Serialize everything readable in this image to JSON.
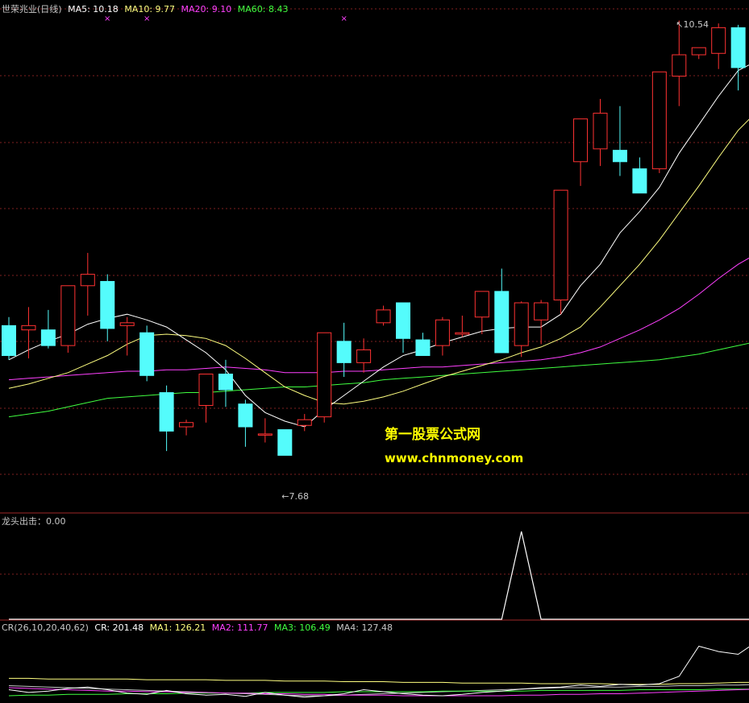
{
  "main_panel": {
    "title": "世荣兆业(日线)",
    "legend": [
      {
        "label": "MA5: 10.18",
        "color": "#ffffff"
      },
      {
        "label": "MA10: 9.77",
        "color": "#ffff80"
      },
      {
        "label": "MA20: 9.10",
        "color": "#ff40ff"
      },
      {
        "label": "MA60: 8.43",
        "color": "#40ff40"
      }
    ],
    "high_label": "10.54",
    "low_label": "7.68"
  },
  "indicator_panel": {
    "label": "龙头出击：0.00"
  },
  "cr_panel": {
    "legend": [
      {
        "label": "CR(26,10,20,40,62)",
        "color": "#c8c8c8"
      },
      {
        "label": "CR: 201.48",
        "color": "#ffffff"
      },
      {
        "label": "MA1: 126.21",
        "color": "#ffff80"
      },
      {
        "label": "MA2: 111.77",
        "color": "#ff40ff"
      },
      {
        "label": "MA3: 106.49",
        "color": "#40ff40"
      },
      {
        "label": "MA4: 127.48",
        "color": "#c8c8c8"
      }
    ]
  },
  "watermark": {
    "line1": "第一股票公式网",
    "line2": "www.chnmoney.com"
  },
  "colors": {
    "up": "#ff3232",
    "down": "#54fcfc",
    "grid": "#802020",
    "ma5": "#ffffff",
    "ma10": "#ffff80",
    "ma20": "#ff40ff",
    "ma60": "#40ff40",
    "marker": "#ff40ff"
  },
  "chart_data": {
    "type": "candlestick",
    "ylim": [
      7.4,
      10.75
    ],
    "candles": [
      {
        "o": 8.59,
        "h": 8.65,
        "l": 8.35,
        "c": 8.38
      },
      {
        "o": 8.56,
        "h": 8.72,
        "l": 8.36,
        "c": 8.59
      },
      {
        "o": 8.56,
        "h": 8.7,
        "l": 8.43,
        "c": 8.45
      },
      {
        "o": 8.45,
        "h": 8.87,
        "l": 8.4,
        "c": 8.87
      },
      {
        "o": 8.87,
        "h": 9.1,
        "l": 8.66,
        "c": 8.95
      },
      {
        "o": 8.9,
        "h": 8.95,
        "l": 8.48,
        "c": 8.57
      },
      {
        "o": 8.59,
        "h": 8.65,
        "l": 8.38,
        "c": 8.61
      },
      {
        "o": 8.54,
        "h": 8.59,
        "l": 8.2,
        "c": 8.24
      },
      {
        "o": 8.12,
        "h": 8.17,
        "l": 7.71,
        "c": 7.85
      },
      {
        "o": 7.88,
        "h": 7.93,
        "l": 7.82,
        "c": 7.91
      },
      {
        "o": 8.03,
        "h": 8.25,
        "l": 7.91,
        "c": 8.25
      },
      {
        "o": 8.25,
        "h": 8.35,
        "l": 8.02,
        "c": 8.14
      },
      {
        "o": 8.04,
        "h": 8.07,
        "l": 7.74,
        "c": 7.88
      },
      {
        "o": 7.83,
        "h": 7.94,
        "l": 7.77,
        "c": 7.83
      },
      {
        "o": 7.86,
        "h": 7.86,
        "l": 7.69,
        "c": 7.68
      },
      {
        "o": 7.89,
        "h": 7.97,
        "l": 7.85,
        "c": 7.93
      },
      {
        "o": 7.95,
        "h": 8.54,
        "l": 7.91,
        "c": 8.54
      },
      {
        "o": 8.48,
        "h": 8.61,
        "l": 8.23,
        "c": 8.33
      },
      {
        "o": 8.33,
        "h": 8.5,
        "l": 8.26,
        "c": 8.42
      },
      {
        "o": 8.61,
        "h": 8.73,
        "l": 8.59,
        "c": 8.7
      },
      {
        "o": 8.75,
        "h": 8.75,
        "l": 8.4,
        "c": 8.5
      },
      {
        "o": 8.49,
        "h": 8.54,
        "l": 8.38,
        "c": 8.38
      },
      {
        "o": 8.45,
        "h": 8.65,
        "l": 8.38,
        "c": 8.63
      },
      {
        "o": 8.53,
        "h": 8.66,
        "l": 8.51,
        "c": 8.54
      },
      {
        "o": 8.65,
        "h": 8.83,
        "l": 8.53,
        "c": 8.83
      },
      {
        "o": 8.83,
        "h": 8.99,
        "l": 8.4,
        "c": 8.4
      },
      {
        "o": 8.45,
        "h": 8.76,
        "l": 8.37,
        "c": 8.75
      },
      {
        "o": 8.63,
        "h": 8.77,
        "l": 8.46,
        "c": 8.75
      },
      {
        "o": 8.77,
        "h": 9.53,
        "l": 8.67,
        "c": 9.54
      },
      {
        "o": 9.74,
        "h": 9.96,
        "l": 9.57,
        "c": 10.04
      },
      {
        "o": 9.83,
        "h": 10.18,
        "l": 9.71,
        "c": 10.08
      },
      {
        "o": 9.82,
        "h": 10.13,
        "l": 9.64,
        "c": 9.74
      },
      {
        "o": 9.69,
        "h": 9.77,
        "l": 9.52,
        "c": 9.52
      },
      {
        "o": 9.69,
        "h": 10.35,
        "l": 9.66,
        "c": 10.37
      },
      {
        "o": 10.34,
        "h": 10.73,
        "l": 10.13,
        "c": 10.49
      },
      {
        "o": 10.49,
        "h": 10.54,
        "l": 10.46,
        "c": 10.54
      },
      {
        "o": 10.5,
        "h": 10.71,
        "l": 10.39,
        "c": 10.68
      },
      {
        "o": 10.68,
        "h": 10.7,
        "l": 10.24,
        "c": 10.4
      },
      {
        "o": 10.36,
        "h": 10.7,
        "l": 10.29,
        "c": 10.6
      }
    ],
    "ma5": [
      8.35,
      8.42,
      8.48,
      8.53,
      8.6,
      8.64,
      8.67,
      8.63,
      8.58,
      8.49,
      8.4,
      8.28,
      8.1,
      7.98,
      7.92,
      7.88,
      8.0,
      8.1,
      8.2,
      8.3,
      8.38,
      8.42,
      8.47,
      8.51,
      8.55,
      8.57,
      8.58,
      8.58,
      8.67,
      8.87,
      9.02,
      9.24,
      9.39,
      9.56,
      9.8,
      10.0,
      10.2,
      10.38,
      10.45
    ],
    "ma10": [
      8.15,
      8.18,
      8.22,
      8.26,
      8.32,
      8.38,
      8.46,
      8.52,
      8.53,
      8.52,
      8.5,
      8.45,
      8.36,
      8.26,
      8.16,
      8.1,
      8.05,
      8.04,
      8.06,
      8.09,
      8.13,
      8.18,
      8.23,
      8.27,
      8.31,
      8.35,
      8.4,
      8.44,
      8.5,
      8.58,
      8.72,
      8.87,
      9.02,
      9.19,
      9.38,
      9.57,
      9.77,
      9.96,
      10.1
    ],
    "ma20": [
      8.21,
      8.22,
      8.23,
      8.24,
      8.25,
      8.26,
      8.27,
      8.27,
      8.28,
      8.28,
      8.29,
      8.3,
      8.29,
      8.28,
      8.26,
      8.26,
      8.26,
      8.27,
      8.27,
      8.28,
      8.29,
      8.3,
      8.3,
      8.31,
      8.32,
      8.33,
      8.34,
      8.35,
      8.37,
      8.4,
      8.44,
      8.5,
      8.56,
      8.63,
      8.71,
      8.81,
      8.92,
      9.02,
      9.1
    ],
    "ma60": [
      7.95,
      7.97,
      7.99,
      8.02,
      8.05,
      8.08,
      8.09,
      8.1,
      8.11,
      8.12,
      8.12,
      8.13,
      8.14,
      8.15,
      8.16,
      8.16,
      8.17,
      8.18,
      8.19,
      8.21,
      8.22,
      8.23,
      8.24,
      8.25,
      8.26,
      8.27,
      8.28,
      8.29,
      8.3,
      8.31,
      8.32,
      8.33,
      8.34,
      8.35,
      8.37,
      8.39,
      8.42,
      8.45,
      8.48
    ],
    "markers": [
      5,
      7,
      17
    ],
    "dragon_signal": [
      0,
      0,
      0,
      0,
      0,
      0,
      0,
      0,
      0,
      0,
      0,
      0,
      0,
      0,
      0,
      0,
      0,
      0,
      0,
      0,
      0,
      0,
      0,
      0,
      0,
      0,
      1,
      0,
      0,
      0,
      0,
      0,
      0,
      0,
      0,
      0,
      0,
      0,
      0
    ],
    "cr": [
      105,
      101,
      103,
      107,
      109,
      105,
      100,
      98,
      104,
      99,
      97,
      98,
      95,
      101,
      97,
      94,
      96,
      99,
      105,
      102,
      99,
      97,
      96,
      98,
      101,
      103,
      106,
      108,
      109,
      112,
      110,
      113,
      112,
      114,
      125,
      170,
      162,
      158,
      178
    ],
    "ma1": [
      122,
      122,
      121,
      121,
      121,
      121,
      121,
      120,
      120,
      120,
      120,
      119,
      119,
      119,
      118,
      118,
      118,
      117,
      117,
      117,
      116,
      116,
      116,
      115,
      115,
      115,
      115,
      114,
      114,
      114,
      114,
      113,
      113,
      113,
      114,
      114,
      115,
      116,
      116
    ],
    "ma2": [
      108,
      107,
      106,
      105,
      104,
      103,
      103,
      102,
      102,
      101,
      101,
      100,
      100,
      99,
      99,
      98,
      98,
      97,
      97,
      97,
      96,
      96,
      96,
      96,
      96,
      96,
      97,
      97,
      98,
      98,
      99,
      99,
      100,
      101,
      102,
      103,
      104,
      105,
      106
    ],
    "ma3": [
      96,
      97,
      97,
      98,
      98,
      98,
      99,
      99,
      99,
      100,
      100,
      100,
      100,
      101,
      101,
      101,
      101,
      102,
      102,
      102,
      102,
      102,
      103,
      103,
      103,
      103,
      103,
      104,
      104,
      104,
      104,
      104,
      105,
      105,
      105,
      105,
      106,
      106,
      106
    ],
    "ma4": [
      111,
      110,
      109,
      108,
      107,
      106,
      105,
      104,
      103,
      102,
      101,
      100,
      99,
      98,
      97,
      96,
      96,
      97,
      98,
      99,
      100,
      101,
      102,
      103,
      104,
      105,
      106,
      107,
      108,
      108,
      109,
      109,
      110,
      110,
      111,
      111,
      112,
      112,
      113
    ],
    "cr_ylim": [
      90,
      185
    ]
  }
}
